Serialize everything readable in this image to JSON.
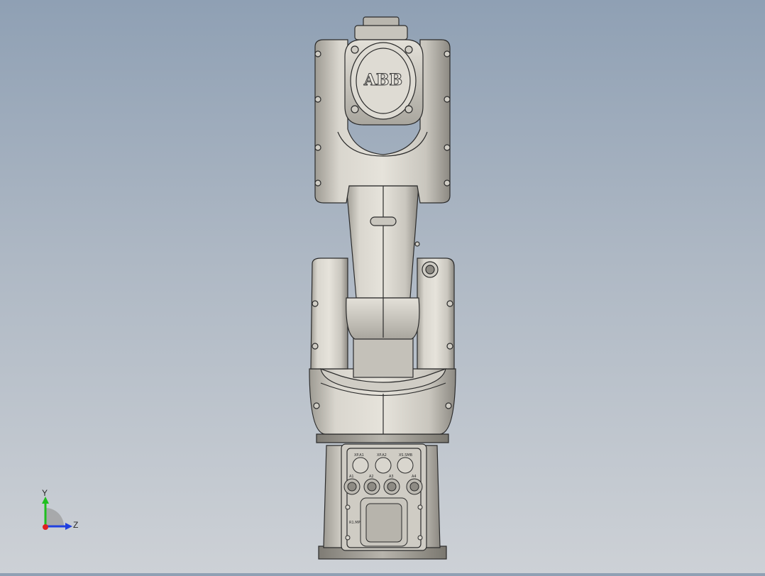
{
  "viewport": {
    "background_top": "#8fa0b4",
    "background_bottom": "#cdd1d6",
    "model_color": "#d6d3cb",
    "edge_color": "#2b2b2b"
  },
  "robot": {
    "brand_text": "ABB",
    "base_panel": {
      "top_labels": [
        "XP.A1",
        "XP.A2",
        "XS.SMB"
      ],
      "mid_labels": [
        "A1",
        "A2",
        "A3",
        "A4"
      ],
      "bottom_label": "R1.MP"
    }
  },
  "triad": {
    "y_label": "Y",
    "z_label": "Z",
    "y_color": "#1fbf1f",
    "z_color": "#2040e0",
    "x_color": "#e02020"
  }
}
